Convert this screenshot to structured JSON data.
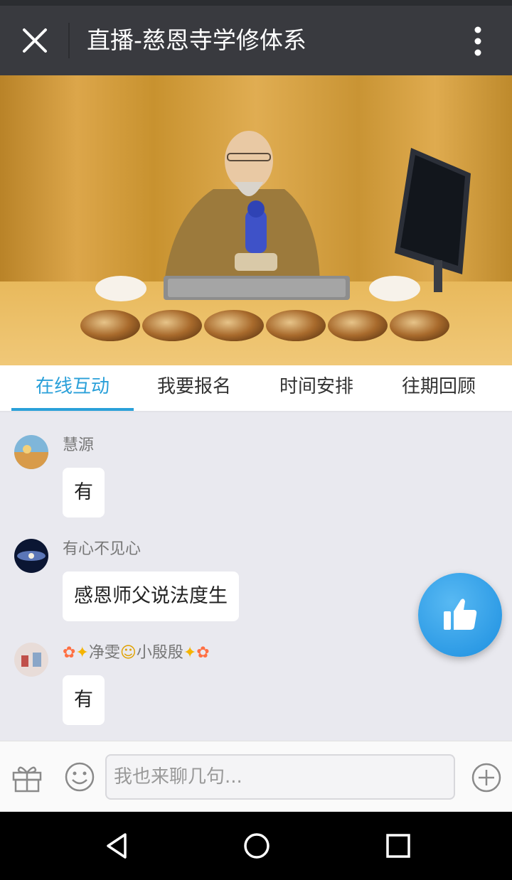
{
  "header": {
    "title": "直播-慈恩寺学修体系",
    "close_icon": "close-icon",
    "more_icon": "more-vertical-icon"
  },
  "video": {
    "content": "live-stream-video"
  },
  "tabs": [
    {
      "label": "在线互动",
      "active": true
    },
    {
      "label": "我要报名",
      "active": false
    },
    {
      "label": "时间安排",
      "active": false
    },
    {
      "label": "往期回顾",
      "active": false
    }
  ],
  "messages": [
    {
      "user": "慧源",
      "text": "有"
    },
    {
      "user": "有心不见心",
      "text": "感恩师父说法度生"
    },
    {
      "user": "净雯",
      "user_suffix": "小殷殷",
      "text": "有"
    }
  ],
  "input": {
    "placeholder": "我也来聊几句..."
  },
  "colors": {
    "accent": "#2aa0d9",
    "header_bg": "#393a3f",
    "chat_bg": "#e9e9ef",
    "like_button": "#2b9ae8"
  }
}
